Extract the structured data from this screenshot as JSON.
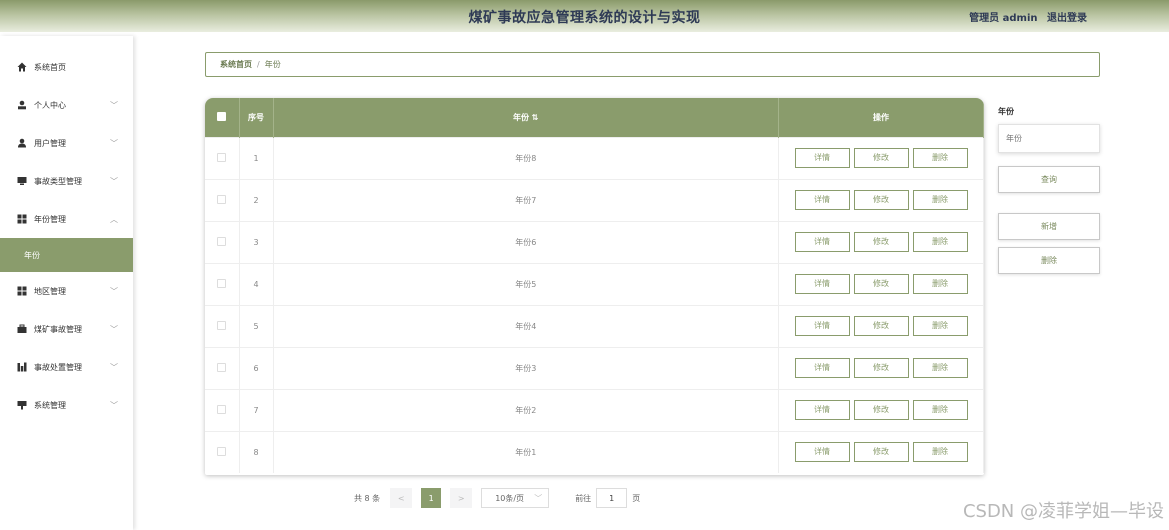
{
  "header": {
    "title": "煤矿事故应急管理系统的设计与实现",
    "user_label": "管理员 admin",
    "logout": "退出登录"
  },
  "sidebar": {
    "items": [
      {
        "label": "系统首页",
        "icon": "home-icon"
      },
      {
        "label": "个人中心",
        "icon": "user-icon"
      },
      {
        "label": "用户管理",
        "icon": "user-icon"
      },
      {
        "label": "事故类型管理",
        "icon": "monitor-icon"
      },
      {
        "label": "年份管理",
        "icon": "grid-icon"
      },
      {
        "label": "地区管理",
        "icon": "grid-icon"
      },
      {
        "label": "煤矿事故管理",
        "icon": "briefcase-icon"
      },
      {
        "label": "事故处置管理",
        "icon": "chart-icon"
      },
      {
        "label": "系统管理",
        "icon": "monitor-icon"
      }
    ],
    "active_sub": "年份"
  },
  "breadcrumb": {
    "home": "系统首页",
    "separator": "/",
    "current": "年份"
  },
  "table": {
    "headers": {
      "seq": "序号",
      "year": "年份 ⇅",
      "ops": "操作"
    },
    "rows": [
      {
        "seq": "1",
        "year": "年份8"
      },
      {
        "seq": "2",
        "year": "年份7"
      },
      {
        "seq": "3",
        "year": "年份6"
      },
      {
        "seq": "4",
        "year": "年份5"
      },
      {
        "seq": "5",
        "year": "年份4"
      },
      {
        "seq": "6",
        "year": "年份3"
      },
      {
        "seq": "7",
        "year": "年份2"
      },
      {
        "seq": "8",
        "year": "年份1"
      }
    ],
    "row_actions": {
      "detail": "详情",
      "edit": "修改",
      "delete": "删除"
    }
  },
  "search": {
    "label": "年份",
    "placeholder": "年份",
    "query_button": "查询",
    "add_button": "新增",
    "delete_button": "删除"
  },
  "pagination": {
    "total": "共 8 条",
    "prev": "<",
    "current_page": "1",
    "next": ">",
    "page_size": "10条/页",
    "goto_label": "前往",
    "goto_value": "1",
    "page_unit": "页"
  },
  "watermark": "CSDN @凌菲学姐—毕设",
  "colors": {
    "accent": "#8a9c6c",
    "title": "#2e3a55"
  }
}
